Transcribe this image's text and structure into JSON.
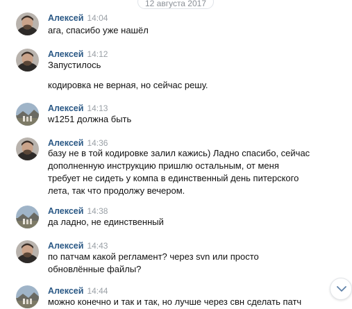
{
  "date_divider": "12 августа 2017",
  "messages": [
    {
      "author": "Алексей",
      "time": "14:04",
      "avatar": "portrait",
      "lines": [
        "ага, спасибо уже нашёл"
      ]
    },
    {
      "author": "Алексей",
      "time": "14:12",
      "avatar": "portrait",
      "lines": [
        "Запустилось",
        "кодировка не верная, но сейчас решу."
      ]
    },
    {
      "author": "Алексей",
      "time": "14:13",
      "avatar": "landscape",
      "lines": [
        "w1251 должна быть"
      ]
    },
    {
      "author": "Алексей",
      "time": "14:36",
      "avatar": "portrait",
      "lines": [
        "базу не в той кодировке залил кажись) Ладно спасибо, сейчас дополненную инструкцию пришлю остальным, от меня требует не сидеть у компа в единственный день питерского лета, так что продолжу вечером."
      ]
    },
    {
      "author": "Алексей",
      "time": "14:38",
      "avatar": "landscape",
      "lines": [
        "да ладно, не единственный"
      ]
    },
    {
      "author": "Алексей",
      "time": "14:43",
      "avatar": "portrait",
      "lines": [
        "по патчам какой регламент? через svn или просто обновлённые файлы?"
      ]
    },
    {
      "author": "Алексей",
      "time": "14:44",
      "avatar": "landscape",
      "lines": [
        "можно конечно и так и так, но лучше через свн сделать патч"
      ]
    }
  ],
  "icons": {
    "scroll_down": "chevron-down-icon"
  },
  "colors": {
    "author": "#2a5885",
    "time": "#9aa0a6",
    "text": "#111111"
  }
}
